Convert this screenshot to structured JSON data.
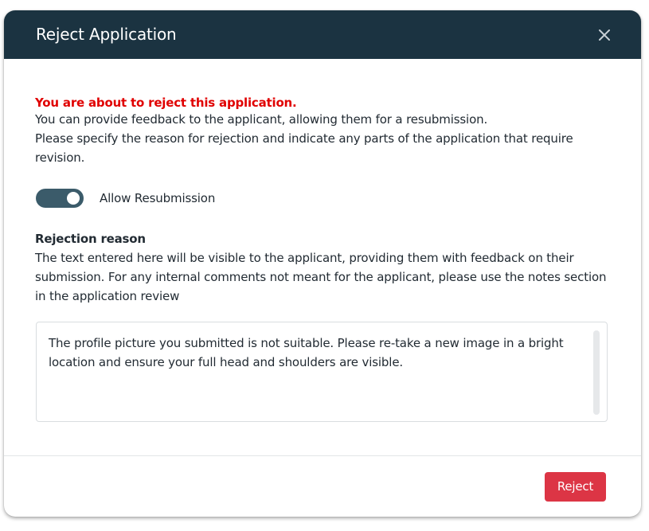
{
  "dialog": {
    "title": "Reject Application",
    "close_icon": "close-icon"
  },
  "body": {
    "warning": "You are about to reject this application.",
    "intro_line1": "You can provide feedback to the applicant, allowing them for a resubmission.",
    "intro_line2": "Please specify the reason for rejection and indicate any parts of the application that require revision.",
    "toggle": {
      "label": "Allow Resubmission",
      "checked": true
    },
    "rejection": {
      "title": "Rejection reason",
      "description": "The text entered here will be visible to the applicant, providing them with feedback on their submission. For any internal comments not meant for the applicant, please use the notes section in the application review",
      "value": "The profile picture you submitted is not suitable. Please re-take a new image in a bright location and ensure your full head and shoulders are visible."
    }
  },
  "footer": {
    "reject_label": "Reject"
  },
  "colors": {
    "header_bg": "#1b3341",
    "warning": "#e00000",
    "toggle_on": "#3b5b6a",
    "reject_button": "#dc3545"
  }
}
